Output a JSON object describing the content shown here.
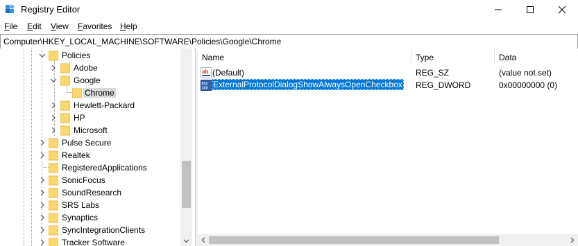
{
  "window": {
    "title": "Registry Editor",
    "icon": "registry-editor-icon",
    "controls": [
      "minimize-icon",
      "maximize-icon",
      "close-icon"
    ]
  },
  "menu": [
    {
      "label": "File",
      "accel": "F",
      "rest": "ile"
    },
    {
      "label": "Edit",
      "accel": "E",
      "rest": "dit"
    },
    {
      "label": "View",
      "accel": "V",
      "rest": "iew"
    },
    {
      "label": "Favorites",
      "accel": "F",
      "rest": "avorites"
    },
    {
      "label": "Help",
      "accel": "H",
      "rest": "elp"
    }
  ],
  "address": "Computer\\HKEY_LOCAL_MACHINE\\SOFTWARE\\Policies\\Google\\Chrome",
  "tree": {
    "items": [
      {
        "label": "Policies",
        "state": "expanded",
        "level": 0
      },
      {
        "label": "Adobe",
        "state": "collapsed",
        "level": 1
      },
      {
        "label": "Google",
        "state": "expanded",
        "level": 1
      },
      {
        "label": "Chrome",
        "state": "selected",
        "level": 2
      },
      {
        "label": "Hewlett-Packard",
        "state": "collapsed",
        "level": 1
      },
      {
        "label": "HP",
        "state": "collapsed",
        "level": 1
      },
      {
        "label": "Microsoft",
        "state": "collapsed",
        "level": 1
      },
      {
        "label": "Pulse Secure",
        "state": "collapsed",
        "level": 0
      },
      {
        "label": "Realtek",
        "state": "collapsed",
        "level": 0
      },
      {
        "label": "RegisteredApplications",
        "state": "leaf",
        "level": 0
      },
      {
        "label": "SonicFocus",
        "state": "collapsed",
        "level": 0
      },
      {
        "label": "SoundResearch",
        "state": "collapsed",
        "level": 0
      },
      {
        "label": "SRS Labs",
        "state": "collapsed",
        "level": 0
      },
      {
        "label": "Synaptics",
        "state": "collapsed",
        "level": 0
      },
      {
        "label": "SyncIntegrationClients",
        "state": "collapsed",
        "level": 0
      },
      {
        "label": "Tracker Software",
        "state": "collapsed",
        "level": 0
      }
    ]
  },
  "list": {
    "columns": [
      "Name",
      "Type",
      "Data"
    ],
    "rows": [
      {
        "name": "(Default)",
        "type": "REG_SZ",
        "data": "(value not set)",
        "icon": "string-value-icon",
        "selected": false
      },
      {
        "name": "ExternalProtocolDialogShowAlwaysOpenCheckbox",
        "type": "REG_DWORD",
        "data": "0x00000000 (0)",
        "icon": "dword-value-icon",
        "selected": true
      }
    ]
  },
  "colors": {
    "selection": "#0078d7",
    "folder": "#f8d775",
    "tree_selection": "#d9d9d9"
  }
}
